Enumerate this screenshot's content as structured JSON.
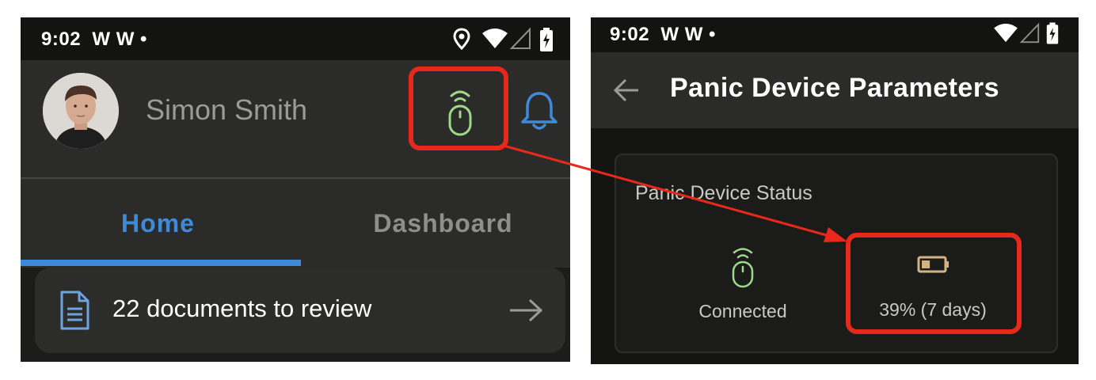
{
  "colors": {
    "highlight": "#e8281b",
    "tab_active": "#3f8ad8",
    "connected_green": "#9ed98a",
    "battery_tan": "#d4b383",
    "bell_blue": "#3f8ad8"
  },
  "left_screen": {
    "status_bar": {
      "time": "9:02",
      "notifications": "W W •",
      "icons": [
        "location-icon",
        "wifi-icon",
        "signal-icon",
        "battery-charging-icon"
      ]
    },
    "header": {
      "user_name": "Simon Smith",
      "panic_device_icon": "panic-device-icon",
      "bell_icon": "bell-icon"
    },
    "tabs": [
      {
        "label": "Home",
        "active": true
      },
      {
        "label": "Dashboard",
        "active": false
      }
    ],
    "documents_card": {
      "icon": "document-icon",
      "text": "22 documents to review",
      "arrow_icon": "arrow-right-icon"
    }
  },
  "right_screen": {
    "status_bar": {
      "time": "9:02",
      "notifications": "W W •",
      "icons": [
        "wifi-icon",
        "signal-icon",
        "battery-charging-icon"
      ]
    },
    "app_bar": {
      "back_icon": "arrow-left-icon",
      "title": "Panic Device Parameters"
    },
    "status_card": {
      "title": "Panic Device Status",
      "connection": {
        "icon": "panic-device-icon",
        "label": "Connected"
      },
      "battery": {
        "icon": "battery-low-icon",
        "level_percent": 39,
        "label": "39% (7 days)"
      }
    }
  }
}
